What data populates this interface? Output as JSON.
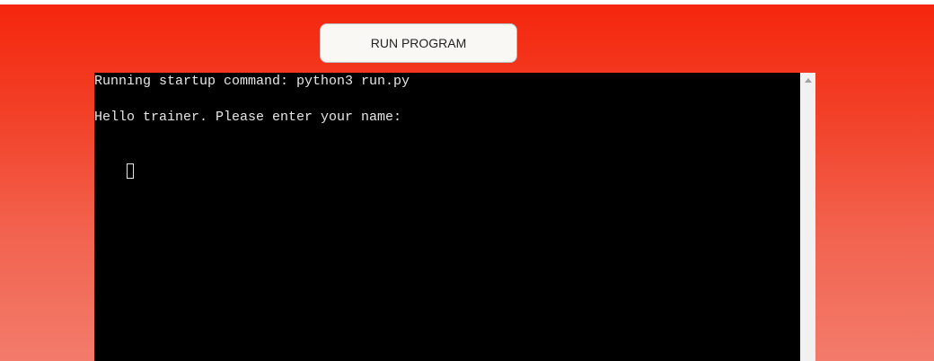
{
  "toolbar": {
    "run_label": "RUN PROGRAM"
  },
  "terminal": {
    "lines": [
      "Running startup command: python3 run.py",
      "Hello trainer. Please enter your name:"
    ]
  },
  "colors": {
    "gradient_top": "#f5250c",
    "gradient_bottom": "#f37b6b",
    "terminal_bg": "#000000",
    "terminal_text": "#e6e6e6",
    "button_bg": "#faf8f4"
  },
  "icons": {
    "scroll_up": "scroll-up-arrow-icon"
  }
}
